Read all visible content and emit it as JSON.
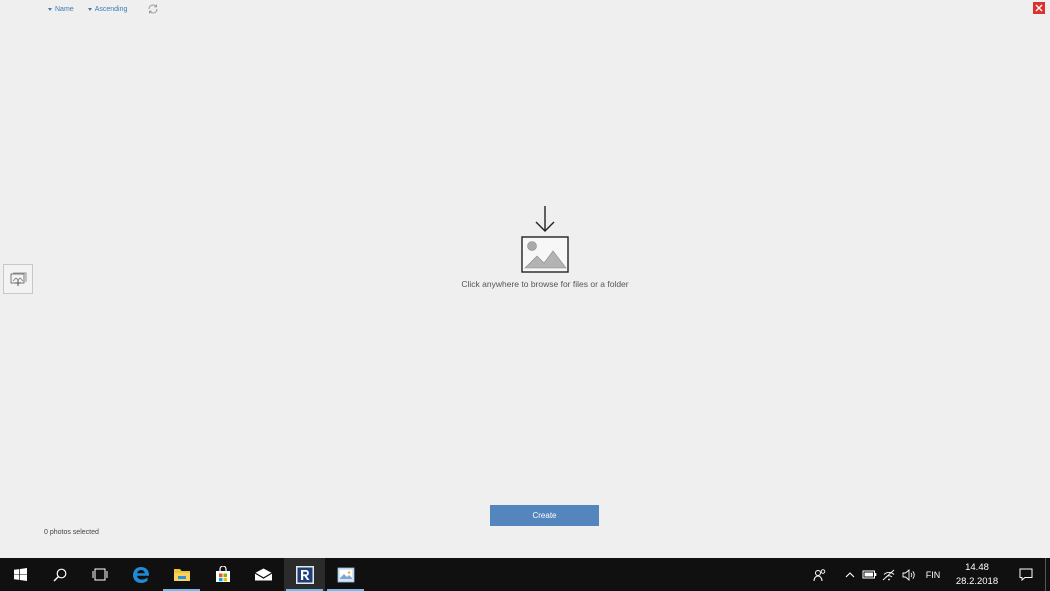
{
  "toolbar": {
    "sort_field": "Name",
    "sort_order": "Ascending",
    "refresh_icon": "refresh-icon",
    "close_icon": "close-icon"
  },
  "sidebar": {
    "add_icon": "add-photos-icon"
  },
  "dropzone": {
    "arrow_icon": "arrow-down-icon",
    "image_icon": "image-placeholder-icon",
    "hint": "Click anywhere to browse for files or a folder"
  },
  "footer": {
    "selected_count": "0 photos selected",
    "create_label": "Create"
  },
  "taskbar": {
    "apps": [
      {
        "name": "windows-start-icon"
      },
      {
        "name": "search-icon"
      },
      {
        "name": "task-view-icon"
      },
      {
        "name": "edge-icon"
      },
      {
        "name": "file-explorer-icon"
      },
      {
        "name": "store-icon"
      },
      {
        "name": "mail-icon"
      },
      {
        "name": "r-app-icon"
      },
      {
        "name": "photo-app-icon"
      }
    ],
    "tray": {
      "language": "FIN",
      "time": "14.48",
      "date": "28.2.2018"
    }
  },
  "colors": {
    "accent": "#5585bd",
    "link": "#3f7ab3",
    "close": "#d9322f",
    "taskbar": "#101010",
    "active_indicator": "#76b9ed"
  }
}
